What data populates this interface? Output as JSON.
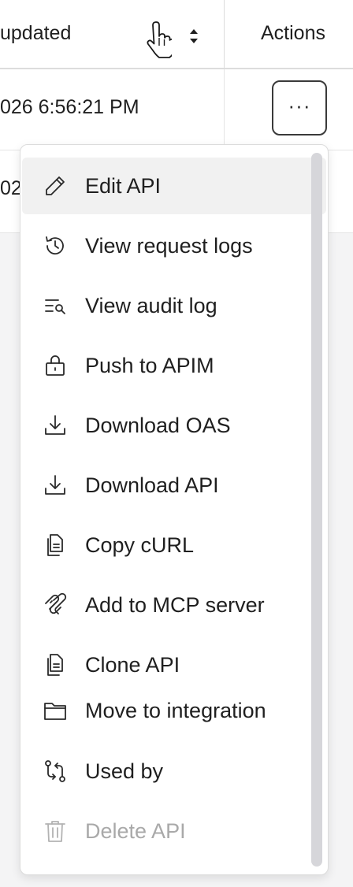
{
  "table": {
    "columns": {
      "updated": "updated",
      "actions": "Actions"
    },
    "rows": [
      {
        "updated": "026 6:56:21 PM"
      },
      {
        "updated": "02"
      }
    ],
    "more_button_label": "···"
  },
  "menu": {
    "items": [
      {
        "label": "Edit API",
        "icon": "pencil-icon",
        "highlighted": true
      },
      {
        "label": "View request logs",
        "icon": "history-icon"
      },
      {
        "label": "View audit log",
        "icon": "search-list-icon"
      },
      {
        "label": "Push to APIM",
        "icon": "lock-open-icon"
      },
      {
        "label": "Download OAS",
        "icon": "download-icon"
      },
      {
        "label": "Download API",
        "icon": "download-icon"
      },
      {
        "label": "Copy cURL",
        "icon": "document-copy-icon"
      },
      {
        "label": "Add to MCP server",
        "icon": "mcp-icon"
      },
      {
        "label": "Clone API",
        "icon": "document-copy-icon"
      },
      {
        "label": "Move to integration",
        "icon": "folder-icon"
      },
      {
        "label": "Used by",
        "icon": "git-compare-icon"
      },
      {
        "label": "Delete API",
        "icon": "trash-icon",
        "disabled": true
      }
    ]
  },
  "colors": {
    "background": "#f4f4f5",
    "highlight": "#f1f1f1",
    "disabled_text": "#a9a9a9",
    "scrollbar": "#d6d6da"
  }
}
